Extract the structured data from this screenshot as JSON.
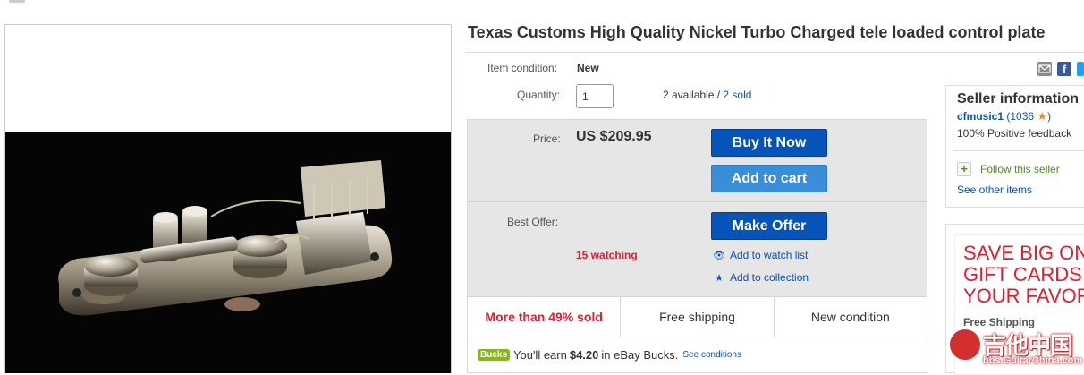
{
  "listing": {
    "title": "Texas Customs High Quality Nickel Turbo Charged tele loaded control plate"
  },
  "item": {
    "condition_label": "Item condition:",
    "condition_value": "New",
    "quantity_label": "Quantity:",
    "quantity_value": "1",
    "available_text": "2 available / ",
    "sold_link": "2 sold"
  },
  "buy": {
    "price_label": "Price:",
    "price_value": "US $209.95",
    "buy_now": "Buy It Now",
    "add_to_cart": "Add to cart",
    "best_offer_label": "Best Offer:",
    "make_offer": "Make Offer",
    "watching": "15 watching",
    "add_watch": "Add to watch list",
    "add_collection": "Add to collection"
  },
  "stats": {
    "sold_pct": "More than 49% sold",
    "shipping": "Free shipping",
    "condition": "New condition"
  },
  "bucks": {
    "badge": "Bucks",
    "prefix": "You'll earn",
    "amount": "$4.20",
    "suffix": "in eBay Bucks.",
    "see": "See conditions"
  },
  "seller": {
    "title": "Seller information",
    "name": "cfmusic1",
    "score": "(1036",
    "score_close": ")",
    "feedback": "100% Positive feedback",
    "follow": "Follow this seller",
    "other_items": "See other items"
  },
  "ad": {
    "line1": "SAVE BIG ON",
    "line2": "GIFT CARDS F",
    "line3": "YOUR FAVORI",
    "shipping": "Free Shipping"
  },
  "watermark": {
    "text": "吉他中国",
    "url": "bbs.GuitarChina.com"
  },
  "colors": {
    "primary_button": "#0654ba",
    "secondary_button": "#3a8dd9",
    "link": "#0654ba",
    "alert_red": "#dd1e31",
    "follow_green": "#4a8f19"
  }
}
